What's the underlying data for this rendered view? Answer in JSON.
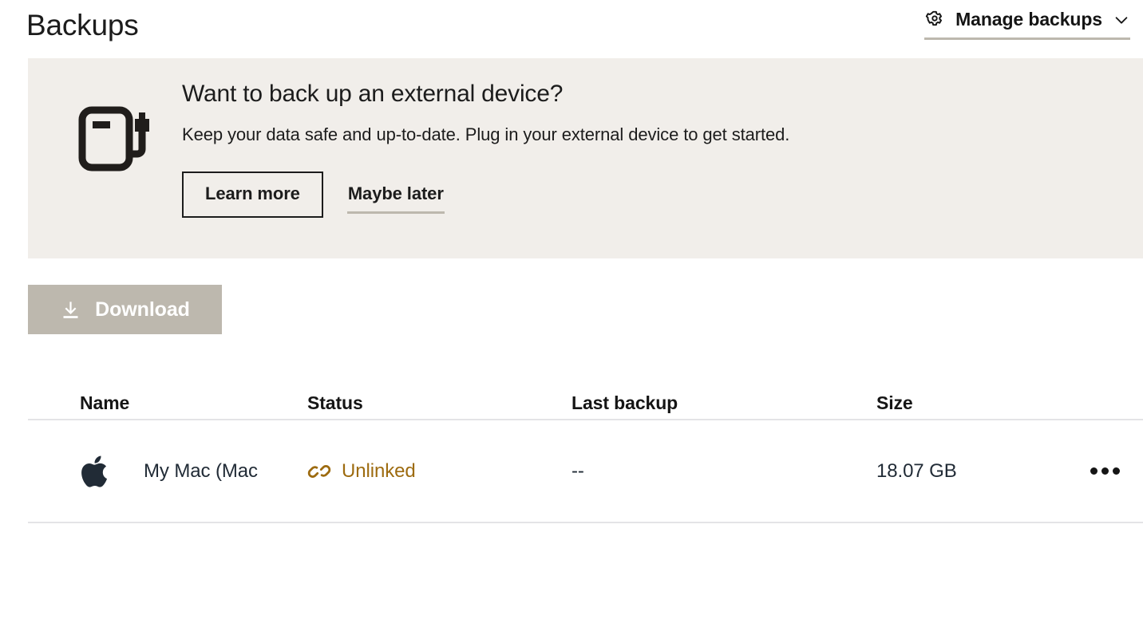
{
  "header": {
    "title": "Backups",
    "manage_backups": {
      "label": "Manage backups",
      "gear_icon": "gear-icon",
      "chevron_icon": "chevron-down-icon"
    }
  },
  "promo_banner": {
    "icon": "external-drive-icon",
    "heading": "Want to back up an external device?",
    "subtext": "Keep your data safe and up-to-date. Plug in your external device to get started.",
    "primary_action": "Learn more",
    "secondary_action": "Maybe later",
    "background_color": "#f1eeea"
  },
  "toolbar": {
    "download_label": "Download",
    "download_icon": "download-icon",
    "download_disabled_color": "#bdb8ae"
  },
  "table": {
    "columns": [
      "Name",
      "Status",
      "Last backup",
      "Size"
    ],
    "rows": [
      {
        "device_icon": "apple-icon",
        "name": "My Mac (Mac",
        "status": "Unlinked",
        "status_icon": "broken-link-icon",
        "status_color": "#9d6b10",
        "last_backup": "--",
        "size": "18.07 GB",
        "menu_icon": "ellipsis-icon"
      }
    ]
  }
}
